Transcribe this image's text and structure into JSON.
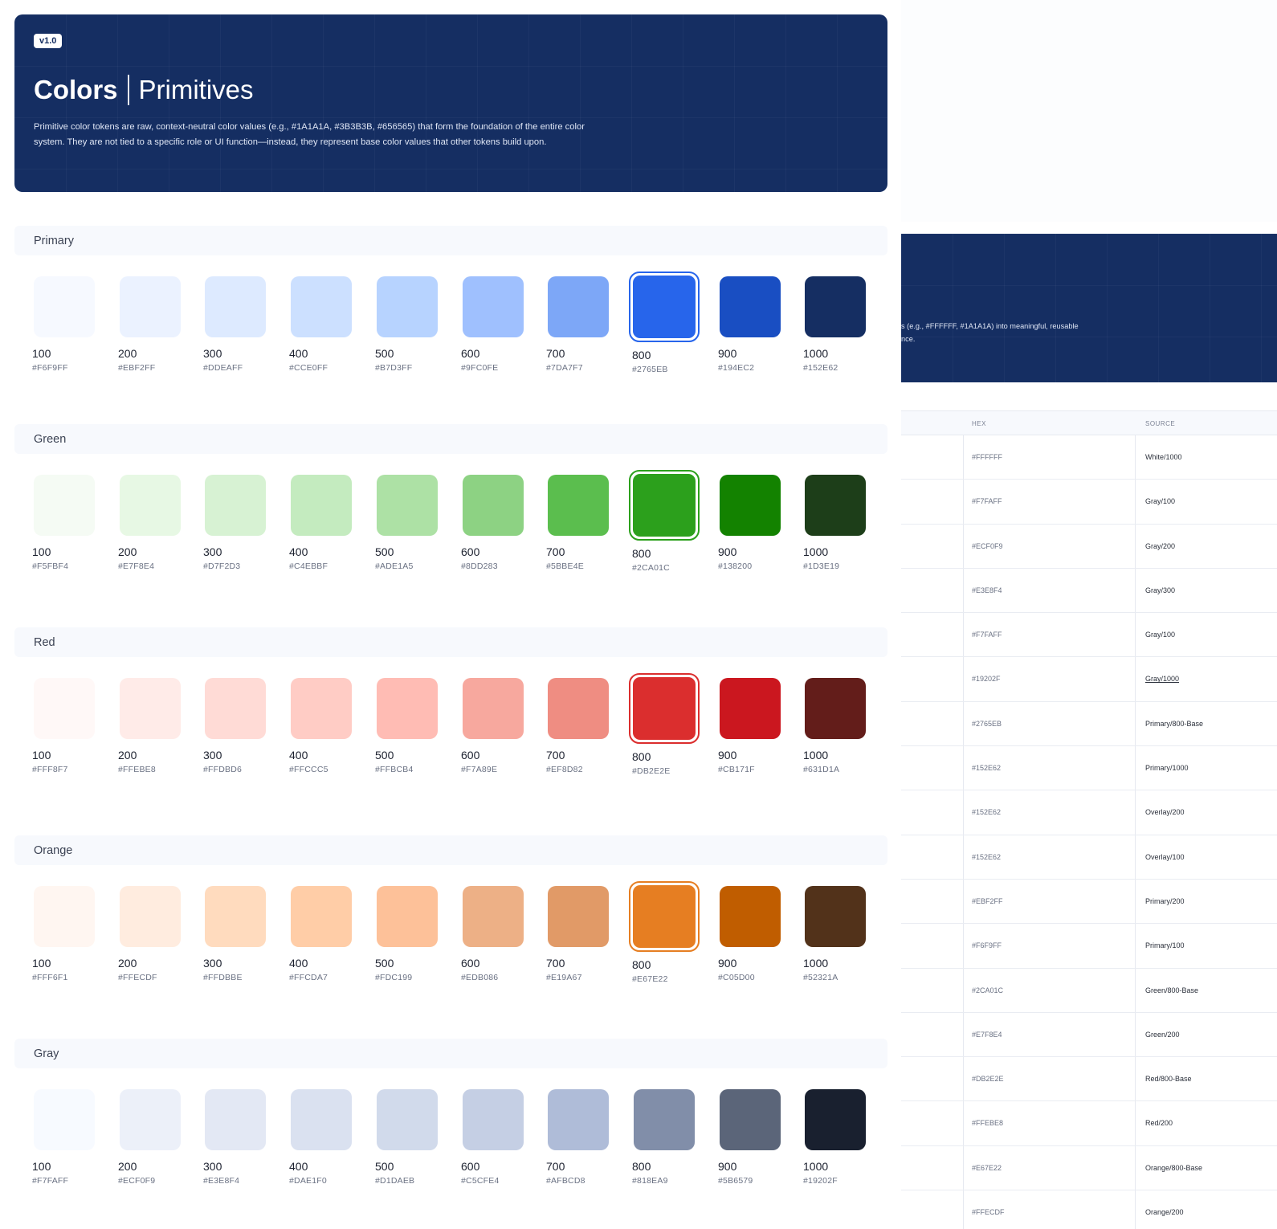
{
  "header": {
    "version": "v1.0",
    "title": "Colors",
    "subtitle": "Primitives",
    "description": "Primitive color tokens are raw, context-neutral color values (e.g., #1A1A1A, #3B3B3B, #656565) that form the foundation of the entire color system. They are not tied to a specific role or UI function—instead, they represent base color values that other tokens build upon."
  },
  "palettes": [
    {
      "name": "Primary",
      "selected_index": 7,
      "swatches": [
        {
          "step": "100",
          "hex": "#F6F9FF"
        },
        {
          "step": "200",
          "hex": "#EBF2FF"
        },
        {
          "step": "300",
          "hex": "#DDEAFF"
        },
        {
          "step": "400",
          "hex": "#CCE0FF"
        },
        {
          "step": "500",
          "hex": "#B7D3FF"
        },
        {
          "step": "600",
          "hex": "#9FC0FE"
        },
        {
          "step": "700",
          "hex": "#7DA7F7"
        },
        {
          "step": "800",
          "hex": "#2765EB"
        },
        {
          "step": "900",
          "hex": "#194EC2"
        },
        {
          "step": "1000",
          "hex": "#152E62"
        }
      ]
    },
    {
      "name": "Green",
      "selected_index": 7,
      "swatches": [
        {
          "step": "100",
          "hex": "#F5FBF4"
        },
        {
          "step": "200",
          "hex": "#E7F8E4"
        },
        {
          "step": "300",
          "hex": "#D7F2D3"
        },
        {
          "step": "400",
          "hex": "#C4EBBF"
        },
        {
          "step": "500",
          "hex": "#ADE1A5"
        },
        {
          "step": "600",
          "hex": "#8DD283"
        },
        {
          "step": "700",
          "hex": "#5BBE4E"
        },
        {
          "step": "800",
          "hex": "#2CA01C"
        },
        {
          "step": "900",
          "hex": "#138200"
        },
        {
          "step": "1000",
          "hex": "#1D3E19"
        }
      ]
    },
    {
      "name": "Red",
      "selected_index": 7,
      "swatches": [
        {
          "step": "100",
          "hex": "#FFF8F7"
        },
        {
          "step": "200",
          "hex": "#FFEBE8"
        },
        {
          "step": "300",
          "hex": "#FFDBD6"
        },
        {
          "step": "400",
          "hex": "#FFCCC5"
        },
        {
          "step": "500",
          "hex": "#FFBCB4"
        },
        {
          "step": "600",
          "hex": "#F7A89E"
        },
        {
          "step": "700",
          "hex": "#EF8D82"
        },
        {
          "step": "800",
          "hex": "#DB2E2E"
        },
        {
          "step": "900",
          "hex": "#CB171F"
        },
        {
          "step": "1000",
          "hex": "#631D1A"
        }
      ]
    },
    {
      "name": "Orange",
      "selected_index": 7,
      "swatches": [
        {
          "step": "100",
          "hex": "#FFF6F1"
        },
        {
          "step": "200",
          "hex": "#FFECDF"
        },
        {
          "step": "300",
          "hex": "#FFDBBE"
        },
        {
          "step": "400",
          "hex": "#FFCDA7"
        },
        {
          "step": "500",
          "hex": "#FDC199"
        },
        {
          "step": "600",
          "hex": "#EDB086"
        },
        {
          "step": "700",
          "hex": "#E19A67"
        },
        {
          "step": "800",
          "hex": "#E67E22"
        },
        {
          "step": "900",
          "hex": "#C05D00"
        },
        {
          "step": "1000",
          "hex": "#52321A"
        }
      ]
    },
    {
      "name": "Gray",
      "selected_index": -1,
      "swatches": [
        {
          "step": "100",
          "hex": "#F7FAFF"
        },
        {
          "step": "200",
          "hex": "#ECF0F9"
        },
        {
          "step": "300",
          "hex": "#E3E8F4"
        },
        {
          "step": "400",
          "hex": "#DAE1F0"
        },
        {
          "step": "500",
          "hex": "#D1DAEB"
        },
        {
          "step": "600",
          "hex": "#C5CFE4"
        },
        {
          "step": "700",
          "hex": "#AFBCD8"
        },
        {
          "step": "800",
          "hex": "#818EA9"
        },
        {
          "step": "900",
          "hex": "#5B6579"
        },
        {
          "step": "1000",
          "hex": "#19202F"
        }
      ]
    }
  ],
  "semantic_panel": {
    "description_lines": [
      "s (e.g., #FFFFFF, #1A1A1A) into meaningful, reusable",
      "nce."
    ],
    "columns": {
      "hex": "HEX",
      "source": "SOURCE"
    },
    "rows": [
      {
        "hex": "#FFFFFF",
        "source": "White/1000"
      },
      {
        "hex": "#F7FAFF",
        "source": "Gray/100"
      },
      {
        "hex": "#ECF0F9",
        "source": "Gray/200"
      },
      {
        "hex": "#E3E8F4",
        "source": "Gray/300"
      },
      {
        "hex": "#F7FAFF",
        "source": "Gray/100"
      },
      {
        "hex": "#19202F",
        "source": "Gray/1000",
        "link": true
      },
      {
        "hex": "#2765EB",
        "source": "Primary/800-Base"
      },
      {
        "hex": "#152E62",
        "source": "Primary/1000"
      },
      {
        "hex": "#152E62",
        "source": "Overlay/200"
      },
      {
        "hex": "#152E62",
        "source": "Overlay/100"
      },
      {
        "hex": "#EBF2FF",
        "source": "Primary/200"
      },
      {
        "hex": "#F6F9FF",
        "source": "Primary/100"
      },
      {
        "hex": "#2CA01C",
        "source": "Green/800-Base"
      },
      {
        "hex": "#E7F8E4",
        "source": "Green/200"
      },
      {
        "hex": "#DB2E2E",
        "source": "Red/800-Base"
      },
      {
        "hex": "#FFEBE8",
        "source": "Red/200"
      },
      {
        "hex": "#E67E22",
        "source": "Orange/800-Base"
      },
      {
        "hex": "#FFECDF",
        "source": "Orange/200"
      }
    ]
  }
}
